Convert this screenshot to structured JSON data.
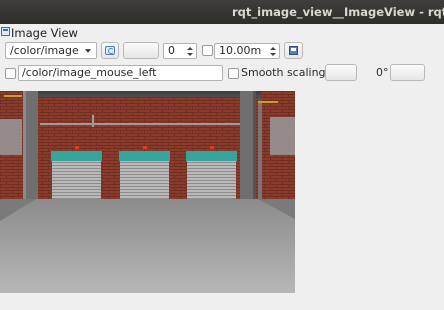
{
  "window": {
    "title": "rqt_image_view__ImageView - rqt"
  },
  "plugin": {
    "title": "Image View",
    "icon": "image-view-icon"
  },
  "toolbar": {
    "topic_value": "/color/image",
    "refresh_icon": "refresh-icon",
    "spin_value": "0",
    "distance_value": "10.00m",
    "save_icon": "save-icon"
  },
  "row2": {
    "mouse_topic_value": "/color/image_mouse_left",
    "smooth_label": "Smooth scaling",
    "rotation_label": "0°"
  },
  "image": {
    "description_icon": "warehouse-image"
  }
}
